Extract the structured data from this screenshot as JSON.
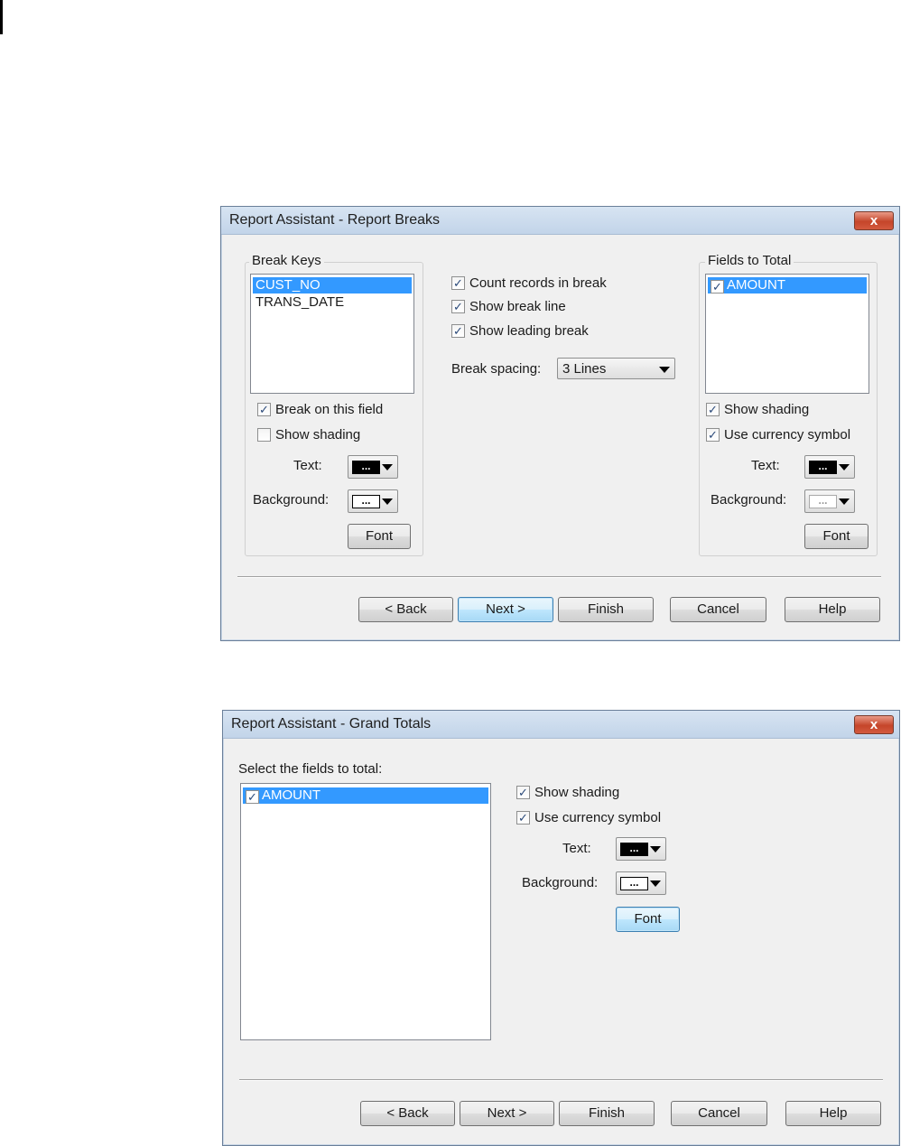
{
  "dialog1": {
    "title": "Report Assistant - Report Breaks",
    "close_label": "x",
    "break_keys": {
      "label": "Break Keys",
      "items": [
        {
          "text": "CUST_NO",
          "selected": true
        },
        {
          "text": "TRANS_DATE",
          "selected": false
        }
      ],
      "break_on_field": {
        "label": "Break on this field",
        "checked": true
      },
      "show_shading": {
        "label": "Show shading",
        "checked": false
      },
      "text_label": "Text:",
      "text_color": "#000000",
      "text_swatch": "...",
      "background_label": "Background:",
      "background_color": "#ffffff",
      "background_swatch": "...",
      "font_button": "Font"
    },
    "middle": {
      "count_records": {
        "label": "Count records in break",
        "checked": true
      },
      "show_break_line": {
        "label": "Show break line",
        "checked": true
      },
      "show_leading_break": {
        "label": "Show leading break",
        "checked": true
      },
      "break_spacing_label": "Break spacing:",
      "break_spacing_value": "3 Lines"
    },
    "fields_to_total": {
      "label": "Fields to Total",
      "items": [
        {
          "text": "AMOUNT",
          "checked": true,
          "selected": true
        }
      ],
      "show_shading": {
        "label": "Show shading",
        "checked": true
      },
      "use_currency": {
        "label": "Use currency symbol",
        "checked": true
      },
      "text_label": "Text:",
      "text_swatch": "...",
      "background_label": "Background:",
      "background_swatch": "...",
      "font_button": "Font"
    },
    "buttons": {
      "back": "< Back",
      "next": "Next >",
      "finish": "Finish",
      "cancel": "Cancel",
      "help": "Help"
    }
  },
  "dialog2": {
    "title": "Report Assistant - Grand Totals",
    "close_label": "x",
    "select_label": "Select the fields to total:",
    "items": [
      {
        "text": "AMOUNT",
        "checked": true,
        "selected": true
      }
    ],
    "show_shading": {
      "label": "Show shading",
      "checked": true
    },
    "use_currency": {
      "label": "Use currency symbol",
      "checked": true
    },
    "text_label": "Text:",
    "text_swatch": "...",
    "background_label": "Background:",
    "background_swatch": "...",
    "font_button": "Font",
    "buttons": {
      "back": "< Back",
      "next": "Next >",
      "finish": "Finish",
      "cancel": "Cancel",
      "help": "Help"
    }
  },
  "check_glyph": "✓",
  "colors": {
    "selection": "#3399ff",
    "title_gradient_top": "#d7e4f2",
    "close_red": "#c5452a",
    "dialog_bg": "#f0f0f0"
  }
}
